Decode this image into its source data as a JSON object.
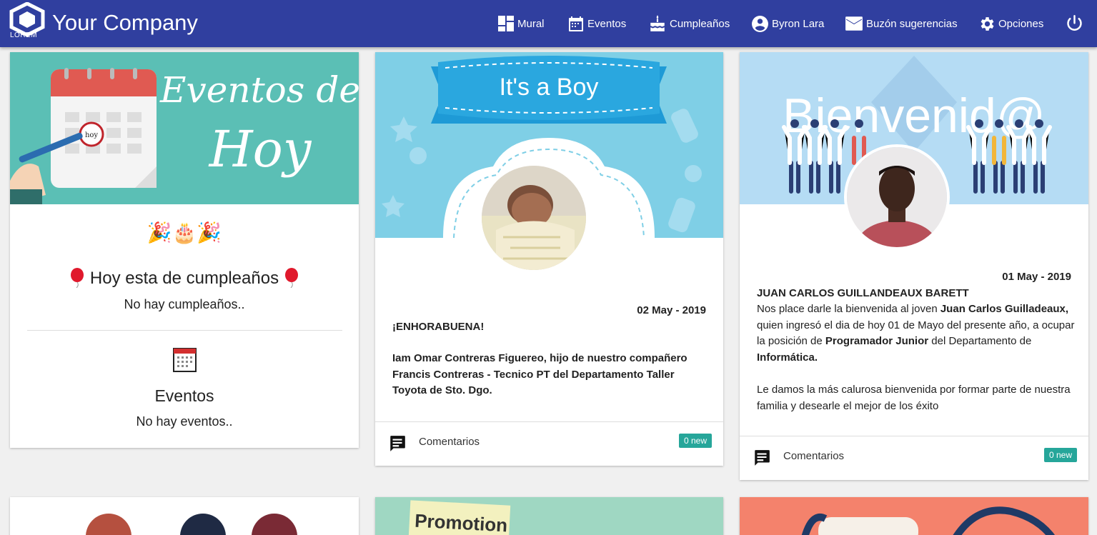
{
  "navbar": {
    "logo_text": "LOREM",
    "brand": "Your Company",
    "items": [
      {
        "label": "Mural",
        "icon": "dashboard-icon"
      },
      {
        "label": "Eventos",
        "icon": "calendar-icon"
      },
      {
        "label": "Cumpleaños",
        "icon": "cake-icon"
      },
      {
        "label": "Byron Lara",
        "icon": "account-circle-icon"
      },
      {
        "label": "Buzón sugerencias",
        "icon": "mail-icon"
      },
      {
        "label": "Opciones",
        "icon": "gear-icon"
      }
    ],
    "power_icon": "power-icon"
  },
  "events_card": {
    "banner_title_line1": "Eventos de",
    "banner_title_line2": "Hoy",
    "banner_hoy": "hoy",
    "emojis": "🎉🎂🎉",
    "birthday_title": "Hoy esta de cumpleaños",
    "no_birthdays": "No hay cumpleaños..",
    "events_title": "Eventos",
    "no_events": "No hay eventos.."
  },
  "boy_card": {
    "banner_text": "It's a Boy",
    "date": "02 May - 2019",
    "heading": "¡ENHORABUENA!",
    "body": "Iam Omar Contreras Figuereo, hijo de nuestro compañero Francis Contreras - Tecnico PT del Departamento Taller Toyota de Sto. Dgo.",
    "comments_label": "Comentarios",
    "badge": "0 new"
  },
  "welcome_card": {
    "banner_text": "Bienvenid@",
    "date": "01 May - 2019",
    "name": "JUAN CARLOS GUILLANDEAUX  BARETT",
    "p1_a": "Nos place darle la bienvenida al joven ",
    "p1_b": "Juan Carlos Guilladeaux,",
    "p1_c": " quien ingresó el  dia de hoy 01 de Mayo del presente año, a ocupar la posición de ",
    "p1_d": "Programador  Junior",
    "p1_e": " del Departamento de ",
    "p1_f": "Informática.",
    "p2": "Le damos la más calurosa bienvenida por formar parte de nuestra familia y desearle el mejor de los éxito",
    "comments_label": "Comentarios",
    "badge": "0 new"
  },
  "bottom_cards": {
    "promotion": "Promotion"
  },
  "colors": {
    "navbar": "#303f9f",
    "badge": "#26a69a",
    "events_banner": "#5bbfb5",
    "boy_banner": "#7fcfe6",
    "welcome_banner": "#b5dcf4"
  }
}
